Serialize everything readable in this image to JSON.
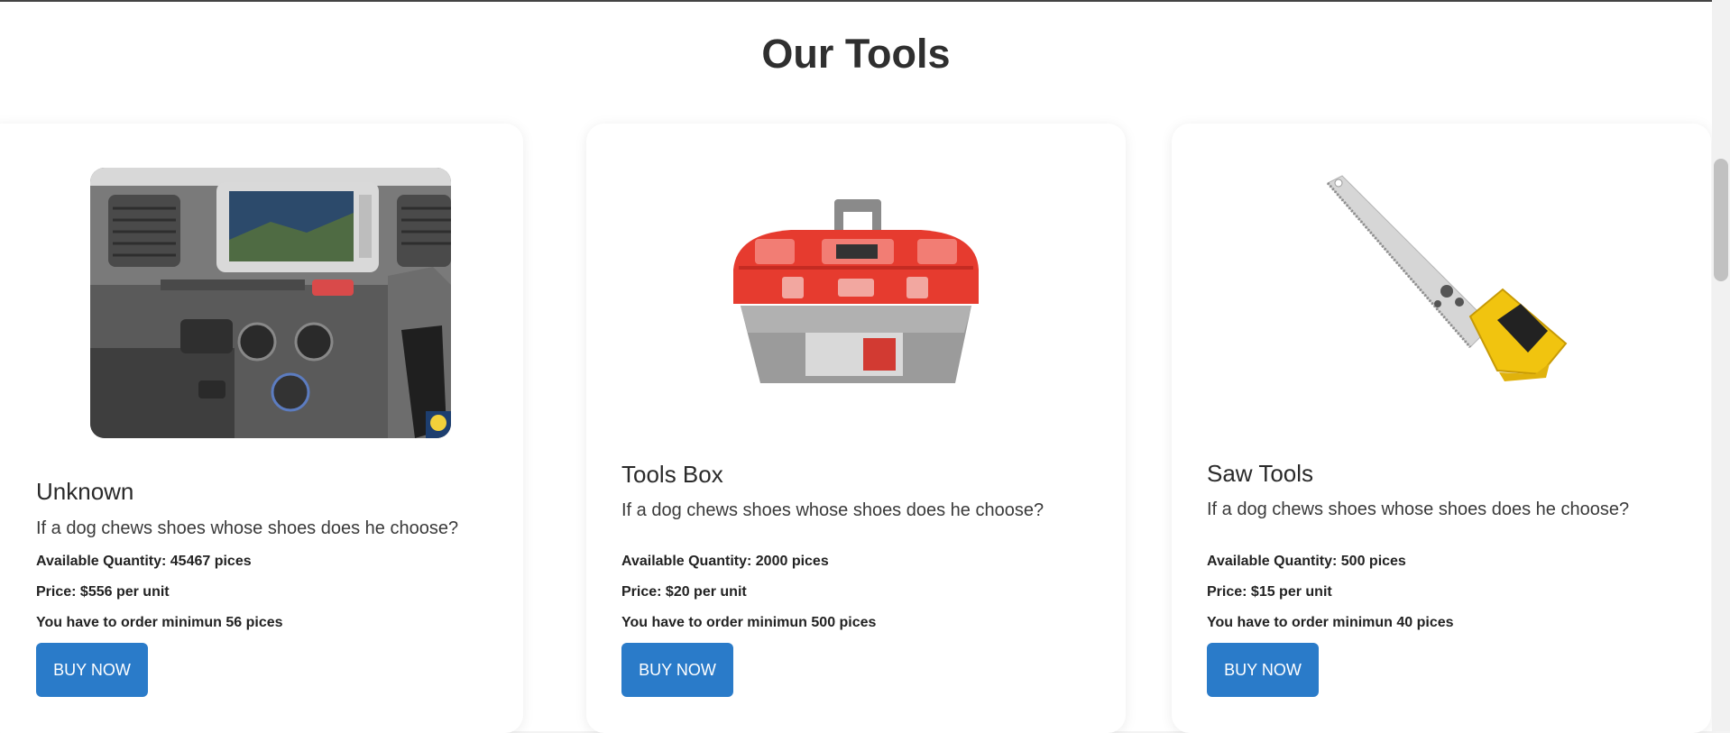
{
  "section": {
    "title": "Our Tools"
  },
  "products": [
    {
      "name": "Unknown",
      "description": "If a dog chews shoes whose shoes does he choose?",
      "quantity": "Available Quantity: 45467 pices",
      "price": "Price: $556 per unit",
      "minimum": "You have to order minimun 56 pices",
      "button": "BUY NOW",
      "image_subject": "car-dashboard-image"
    },
    {
      "name": "Tools Box",
      "description": "If a dog chews shoes whose shoes does he choose?",
      "quantity": "Available Quantity: 2000 pices",
      "price": "Price: $20 per unit",
      "minimum": "You have to order minimun 500 pices",
      "button": "BUY NOW",
      "image_subject": "toolbox-image"
    },
    {
      "name": "Saw Tools",
      "description": "If a dog chews shoes whose shoes does he choose?",
      "quantity": "Available Quantity: 500 pices",
      "price": "Price: $15 per unit",
      "minimum": "You have to order minimun 40 pices",
      "button": "BUY NOW",
      "image_subject": "hand-saw-image"
    }
  ],
  "colors": {
    "button": "#2a7bc9",
    "background": "#ffffff"
  }
}
